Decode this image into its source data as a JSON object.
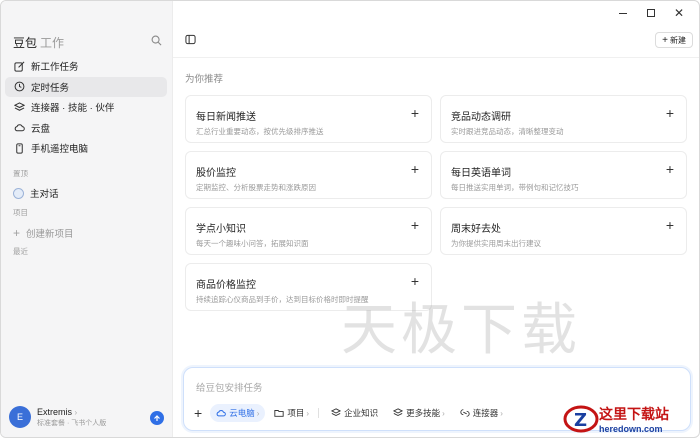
{
  "app": {
    "brand": "豆包",
    "brand_sub": "工作"
  },
  "sidebar": {
    "items": [
      {
        "label": "新工作任务",
        "icon": "edit-icon"
      },
      {
        "label": "定时任务",
        "icon": "clock-icon"
      },
      {
        "label": "连接器 · 技能 · 伙伴",
        "icon": "layers-icon"
      },
      {
        "label": "云盘",
        "icon": "cloud-icon"
      },
      {
        "label": "手机遥控电脑",
        "icon": "phone-icon"
      }
    ],
    "section_pinned": "置顶",
    "pinned_item": "主对话",
    "section_projects": "项目",
    "create_project": "创建新项目",
    "section_recent": "最近"
  },
  "user": {
    "initial": "E",
    "name": "Extremis",
    "plan": "标准套餐 · 飞书个人版"
  },
  "header": {
    "new_label": "新建"
  },
  "main": {
    "section_title": "为你推荐",
    "cards": [
      {
        "title": "每日新闻推送",
        "desc": "汇总行业重要动态，按优先级排序推送"
      },
      {
        "title": "竞品动态调研",
        "desc": "实时跟进竞品动态，清晰整理变动"
      },
      {
        "title": "股价监控",
        "desc": "定期监控、分析股票走势和涨跌原因"
      },
      {
        "title": "每日英语单词",
        "desc": "每日推送实用单词，带例句和记忆技巧"
      },
      {
        "title": "学点小知识",
        "desc": "每天一个趣味小问答，拓展知识面"
      },
      {
        "title": "周末好去处",
        "desc": "为你提供实用周末出行建议"
      },
      {
        "title": "商品价格监控",
        "desc": "持续追踪心仪商品到手价，达到目标价格时即时提醒"
      }
    ]
  },
  "composer": {
    "placeholder": "给豆包安排任务",
    "tools": [
      {
        "label": "云电脑",
        "active": true
      },
      {
        "label": "项目",
        "active": false
      },
      {
        "label": "企业知识",
        "active": false
      },
      {
        "label": "更多技能",
        "active": false
      },
      {
        "label": "连接器",
        "active": false
      }
    ]
  },
  "watermark": "天极下载",
  "site_badge": {
    "name": "这里下载站",
    "url_text": "heredown.com"
  },
  "colors": {
    "accent": "#2f6fe6",
    "sidebar_bg": "#f5f5f6",
    "active_item_bg": "#e8e8ea"
  }
}
